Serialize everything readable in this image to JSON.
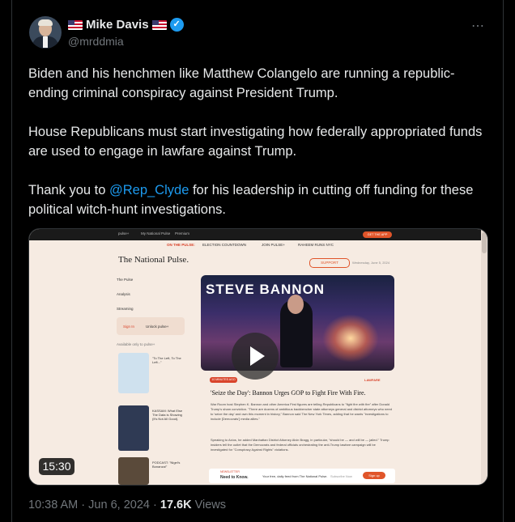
{
  "tweet": {
    "author_name": "Mike Davis",
    "handle": "@mrddmia",
    "more_icon": "⋯",
    "verified_icon": "✓",
    "paragraph_1": "Biden and his henchmen like Matthew Colangelo are running a republic-ending criminal conspiracy against President Trump.",
    "paragraph_2": "House Republicans must start investigating how federally appropriated funds are used to engage in lawfare against Trump.",
    "paragraph_3_prefix": "Thank you to ",
    "mention": "@Rep_Clyde",
    "paragraph_3_suffix": " for his leadership in cutting off funding for these political witch-hunt investigations.",
    "time": "10:38 AM",
    "date": "Jun 6, 2024",
    "views_count": "17.6K",
    "views_label": "Views",
    "separator": "·"
  },
  "media": {
    "duration": "15:30",
    "site": {
      "top_nav": [
        "pulse+",
        "My National Pulse",
        "Premium",
        "GET THE APP"
      ],
      "ticker": [
        "ON THE PULSE:",
        "ELECTION COUNTDOWN",
        "JOIN PULSE+",
        "RAHEEM RUNS NYC"
      ],
      "logo": "The National Pulse.",
      "support": "SUPPORT",
      "date": "Wednesday, June 5, 2024",
      "nav": [
        "The Pulse",
        "Analysis",
        "Streaming"
      ],
      "signin": "Sign In",
      "unlock": "Unlock pulse+",
      "available_only": "Available only to pulse+",
      "side_items": [
        "\"To The Left, To The Left...\"",
        "KASSAM: What Else The Data is Showing (It's Not All Good).",
        "PODCAST: \"Nigel's Bonanza!\""
      ],
      "video_banner": "STEVE BANNON",
      "tag": "10 MINUTES AGO",
      "category": "LAWFARE",
      "headline": "'Seize the Day': Bannon Urges GOP to Fight Fire With Fire.",
      "para_1": "War Room host Stephen K. Bannon and other America First figures are telling Republicans to \"fight fire with fire\" after Donald Trump's sham conviction. \"There are dozens of ambitious backbencher state attorneys general and district attorneys who need to 'seize the day' and own this moment in history,\" Bannon said The New York Times, adding that he wants \"investigations to include [Democrats'] media allies.\"",
      "para_2": "Speaking to Axios, he added Manhattan District Attorney Alvin Bragg, in particular, \"should be — and will be — jailed.\" Trump insiders tell the outlet that the Democrats and federal officials orchestrating the anti-Trump lawfare campaign will be investigated for \"Conspiracy Against Rights\" violations.",
      "newsletter_label": "NEWSLETTER",
      "newsletter_title": "Need to Know.",
      "newsletter_desc": "Your free, daily feed from The National Pulse.",
      "subscribe_placeholder": "Subscribe Now",
      "signup": "Sign up"
    }
  }
}
